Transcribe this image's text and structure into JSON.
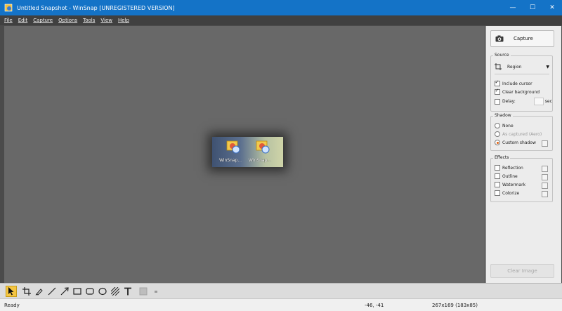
{
  "window": {
    "title": "Untitled Snapshot - WinSnap  [UNREGISTERED VERSION]",
    "controls": {
      "minimize": "—",
      "maximize": "☐",
      "close": "✕"
    }
  },
  "menu": [
    "File",
    "Edit",
    "Capture",
    "Options",
    "Tools",
    "View",
    "Help"
  ],
  "snapshot": {
    "items": [
      {
        "label": "WinSnap..."
      },
      {
        "label": "WinSnap..."
      }
    ]
  },
  "panel": {
    "capture_label": "Capture",
    "source": {
      "legend": "Source",
      "mode": "Region",
      "include_cursor": "Include cursor",
      "clear_background": "Clear background",
      "delay": "Delay:",
      "delay_unit": "sec"
    },
    "shadow": {
      "legend": "Shadow",
      "none": "None",
      "as_captured": "As captured (Aero)",
      "custom": "Custom shadow"
    },
    "effects": {
      "legend": "Effects",
      "items": [
        "Reflection",
        "Outline",
        "Watermark",
        "Colorize"
      ]
    },
    "clear_image": "Clear Image"
  },
  "status": {
    "ready": "Ready",
    "coords": "-46, -41",
    "size": "267x169 (183x85)"
  },
  "colors": {
    "titlebar": "#1473c7",
    "canvas": "#686868",
    "panel": "#ececec",
    "active_tool": "#f4c542",
    "radio_selected": "#e06010"
  }
}
